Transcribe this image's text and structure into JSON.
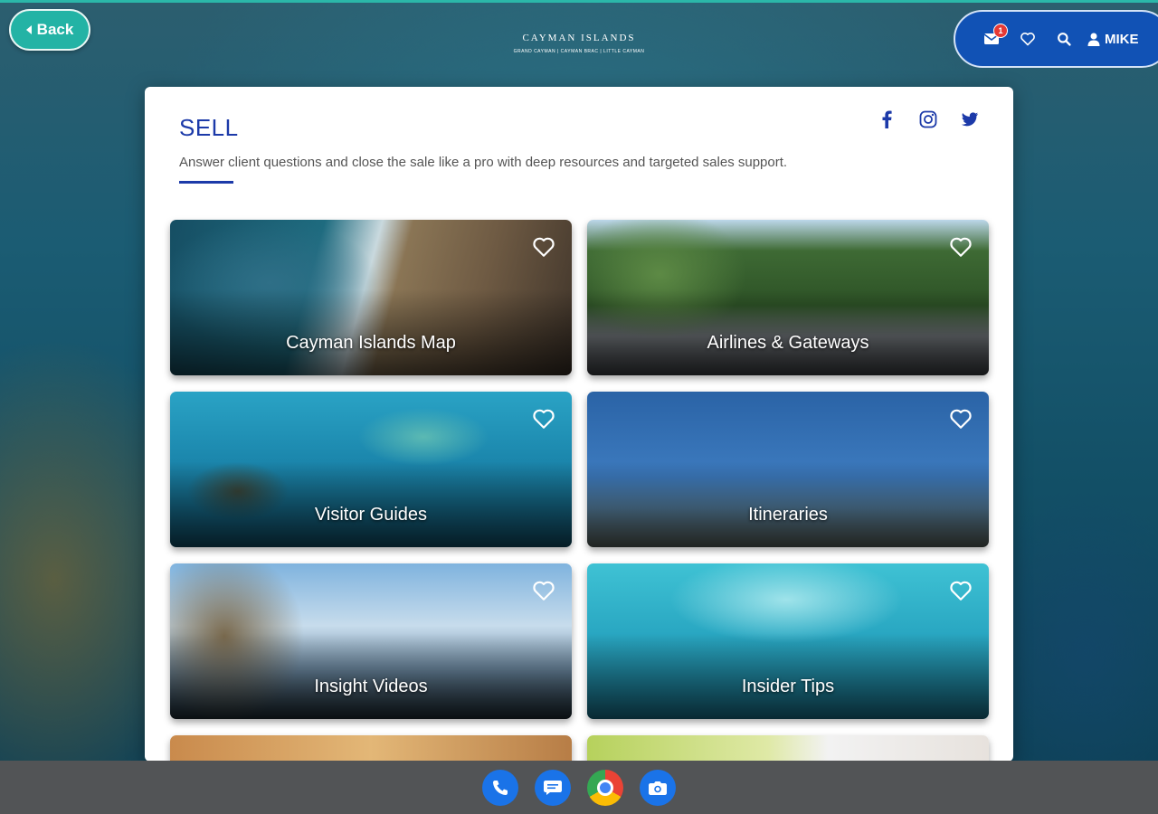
{
  "app": {
    "back_label": "Back",
    "logo_text": "CAYMAN ISLANDS",
    "logo_subtext": "GRAND CAYMAN | CAYMAN BRAC | LITTLE CAYMAN"
  },
  "user_bar": {
    "notification_count": "1",
    "user_name": "MIKE",
    "icons": [
      "mail-icon",
      "heart-icon",
      "search-icon",
      "user-icon"
    ]
  },
  "section": {
    "title": "SELL",
    "description": "Answer client questions and close the sale like a pro with deep resources and targeted sales support.",
    "socials": [
      "facebook-icon",
      "instagram-icon",
      "twitter-icon"
    ]
  },
  "cards": [
    {
      "title": "Cayman Islands Map"
    },
    {
      "title": "Airlines & Gateways"
    },
    {
      "title": "Visitor Guides"
    },
    {
      "title": "Itineraries"
    },
    {
      "title": "Insight Videos"
    },
    {
      "title": "Insider Tips"
    },
    {
      "title": ""
    },
    {
      "title": ""
    }
  ],
  "taskbar": {
    "apps": [
      "phone-icon",
      "messages-icon",
      "chrome-icon",
      "camera-icon"
    ]
  },
  "colors": {
    "accent_teal": "#23b3a5",
    "brand_blue": "#1152b5",
    "title_blue": "#1c3aa9"
  }
}
